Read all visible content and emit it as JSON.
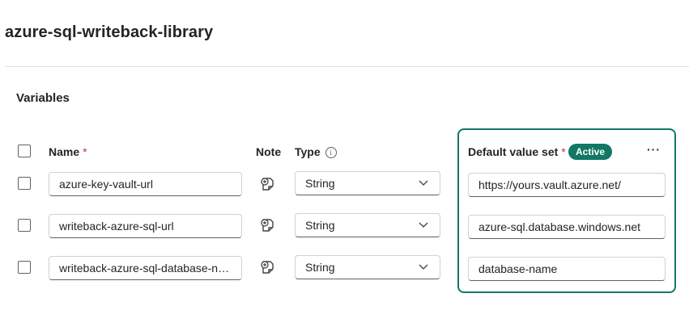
{
  "library": {
    "title": "azure-sql-writeback-library"
  },
  "section": {
    "title": "Variables"
  },
  "columns": {
    "name": "Name",
    "note": "Note",
    "type": "Type",
    "default_value_set": "Default value set",
    "required_marker": "*",
    "info_glyph": "i"
  },
  "default_set": {
    "status": "Active",
    "more_label": "···"
  },
  "variables": [
    {
      "name": "azure-key-vault-url",
      "type": "String",
      "default_value": "https://yours.vault.azure.net/"
    },
    {
      "name": "writeback-azure-sql-url",
      "type": "String",
      "default_value": "azure-sql.database.windows.net"
    },
    {
      "name": "writeback-azure-sql-database-name",
      "type": "String",
      "default_value": "database-name"
    }
  ],
  "icons": {
    "note": "note-add-icon",
    "chevron": "chevron-down-icon",
    "info": "info-icon"
  },
  "colors": {
    "accent": "#117865",
    "required": "#c4314b"
  }
}
